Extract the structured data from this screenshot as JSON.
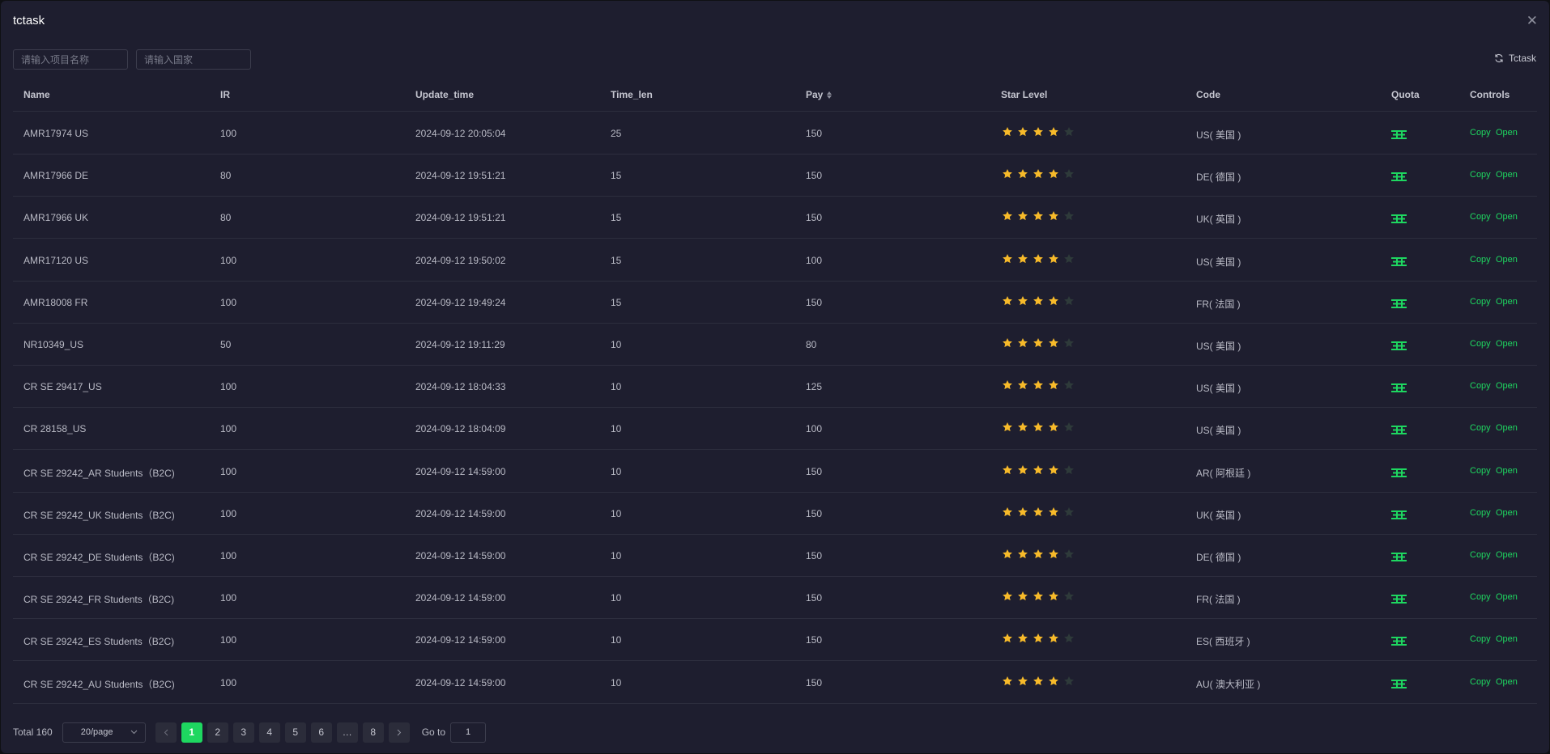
{
  "dialog": {
    "title": "tctask",
    "close_icon": "close-icon"
  },
  "filters": {
    "project_placeholder": "请输入项目名称",
    "country_placeholder": "请输入国家",
    "refresh_label": "Tctask"
  },
  "table": {
    "columns": [
      "Name",
      "IR",
      "Update_time",
      "Time_len",
      "Pay",
      "Star Level",
      "Code",
      "Quota",
      "Controls"
    ],
    "rows": [
      {
        "name": "AMR17974 US",
        "ir": "100",
        "update_time": "2024-09-12 20:05:04",
        "time_len": "25",
        "pay": "150",
        "stars": 4,
        "code": "US( 美国 )"
      },
      {
        "name": "AMR17966 DE",
        "ir": "80",
        "update_time": "2024-09-12 19:51:21",
        "time_len": "15",
        "pay": "150",
        "stars": 4,
        "code": "DE( 德国 )"
      },
      {
        "name": "AMR17966 UK",
        "ir": "80",
        "update_time": "2024-09-12 19:51:21",
        "time_len": "15",
        "pay": "150",
        "stars": 4,
        "code": "UK( 英国 )"
      },
      {
        "name": "AMR17120 US",
        "ir": "100",
        "update_time": "2024-09-12 19:50:02",
        "time_len": "15",
        "pay": "100",
        "stars": 4,
        "code": "US( 美国 )"
      },
      {
        "name": "AMR18008 FR",
        "ir": "100",
        "update_time": "2024-09-12 19:49:24",
        "time_len": "15",
        "pay": "150",
        "stars": 4,
        "code": "FR( 法国 )"
      },
      {
        "name": "NR10349_US",
        "ir": "50",
        "update_time": "2024-09-12 19:11:29",
        "time_len": "10",
        "pay": "80",
        "stars": 4,
        "code": "US( 美国 )"
      },
      {
        "name": "CR SE 29417_US",
        "ir": "100",
        "update_time": "2024-09-12 18:04:33",
        "time_len": "10",
        "pay": "125",
        "stars": 4,
        "code": "US( 美国 )"
      },
      {
        "name": "CR 28158_US",
        "ir": "100",
        "update_time": "2024-09-12 18:04:09",
        "time_len": "10",
        "pay": "100",
        "stars": 4,
        "code": "US( 美国 )"
      },
      {
        "name": "CR SE 29242_AR Students（B2C)",
        "ir": "100",
        "update_time": "2024-09-12 14:59:00",
        "time_len": "10",
        "pay": "150",
        "stars": 4,
        "code": "AR( 阿根廷 )"
      },
      {
        "name": "CR SE 29242_UK Students（B2C)",
        "ir": "100",
        "update_time": "2024-09-12 14:59:00",
        "time_len": "10",
        "pay": "150",
        "stars": 4,
        "code": "UK( 英国 )"
      },
      {
        "name": "CR SE 29242_DE Students（B2C)",
        "ir": "100",
        "update_time": "2024-09-12 14:59:00",
        "time_len": "10",
        "pay": "150",
        "stars": 4,
        "code": "DE( 德国 )"
      },
      {
        "name": "CR SE 29242_FR Students（B2C)",
        "ir": "100",
        "update_time": "2024-09-12 14:59:00",
        "time_len": "10",
        "pay": "150",
        "stars": 4,
        "code": "FR( 法国 )"
      },
      {
        "name": "CR SE 29242_ES Students（B2C)",
        "ir": "100",
        "update_time": "2024-09-12 14:59:00",
        "time_len": "10",
        "pay": "150",
        "stars": 4,
        "code": "ES( 西班牙 )"
      },
      {
        "name": "CR SE 29242_AU Students（B2C)",
        "ir": "100",
        "update_time": "2024-09-12 14:59:00",
        "time_len": "10",
        "pay": "150",
        "stars": 4,
        "code": "AU( 澳大利亚 )"
      }
    ],
    "max_stars": 5,
    "copy_label": "Copy",
    "open_label": "Open",
    "quota_icon": "quota-icon"
  },
  "pagination": {
    "total_label": "Total 160",
    "page_size": "20/page",
    "pages": [
      "1",
      "2",
      "3",
      "4",
      "5",
      "6",
      "…",
      "8"
    ],
    "current": "1",
    "goto_label": "Go to",
    "goto_value": "1"
  },
  "colors": {
    "background": "#1e1e2f",
    "accent": "#1ed760",
    "star_on": "#f7ba2a",
    "star_off": "#2e3a3a"
  }
}
